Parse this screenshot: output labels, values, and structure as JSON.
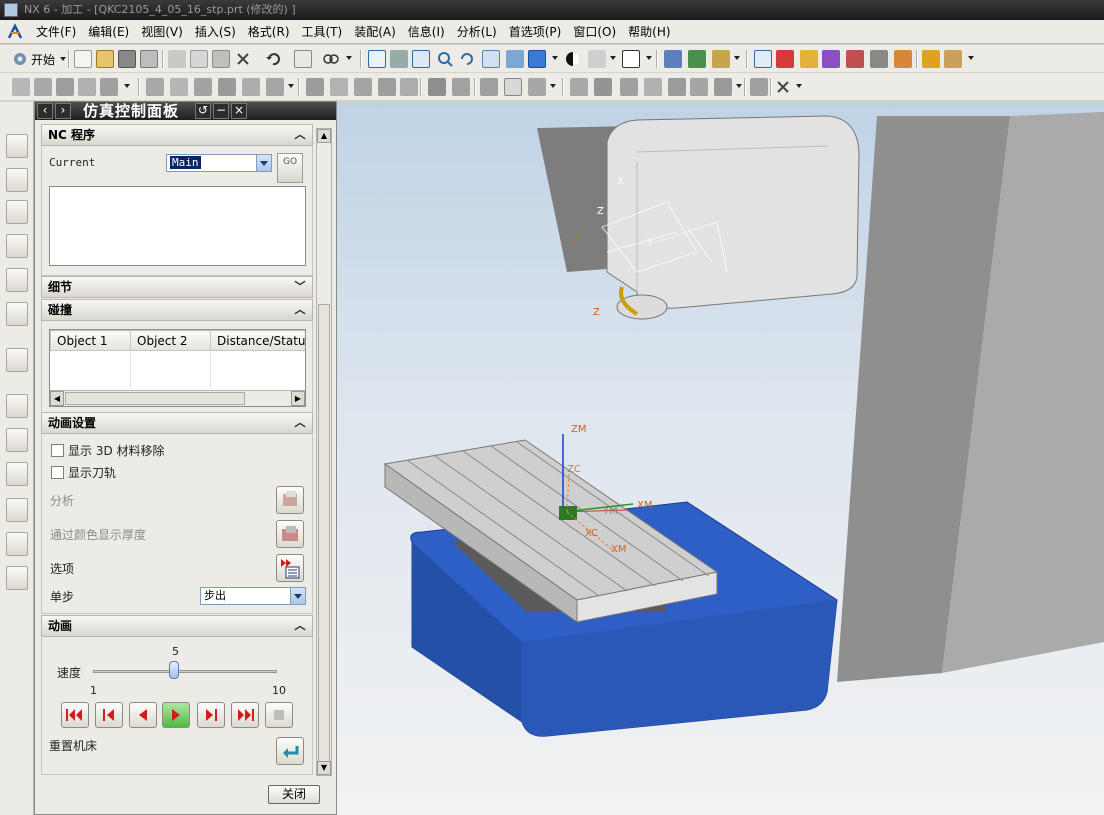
{
  "window": {
    "title": "NX 6 - 加工 - [QKC2105_4_05_16_stp.prt (修改的) ]"
  },
  "menubar": {
    "items": [
      "文件(F)",
      "编辑(E)",
      "视图(V)",
      "插入(S)",
      "格式(R)",
      "工具(T)",
      "装配(A)",
      "信息(I)",
      "分析(L)",
      "首选项(P)",
      "窗口(O)",
      "帮助(H)"
    ]
  },
  "toolbar": {
    "start_label": "开始"
  },
  "panel": {
    "title": "仿真控制面板",
    "nc": {
      "header": "NC 程序",
      "current_label": "Current",
      "current_value": "Main",
      "go_label": "GO"
    },
    "detail": {
      "header": "细节"
    },
    "collision": {
      "header": "碰撞",
      "columns": [
        "Object 1",
        "Object 2",
        "Distance/Statu"
      ]
    },
    "anim_settings": {
      "header": "动画设置",
      "show_3d_removal": "显示 3D 材料移除",
      "show_toolpath": "显示刀轨",
      "analysis": "分析",
      "color_thickness": "通过颜色显示厚度",
      "options": "选项",
      "step_label": "单步",
      "step_value": "步出"
    },
    "animation": {
      "header": "动画",
      "speed_label": "速度",
      "speed_value": "5",
      "speed_min": "1",
      "speed_max": "10",
      "speed_fraction": 0.44,
      "reset_label": "重置机床"
    },
    "close_label": "关闭"
  },
  "viewport": {
    "axis_labels": {
      "zm": "ZM",
      "zc": "ZC",
      "xm": "XM",
      "xc": "XC",
      "ym": "YM",
      "x": "X",
      "y": "Y",
      "z": "Z"
    },
    "colors": {
      "table_blue": "#2d5fc6",
      "column_gray": "#9a9a9a",
      "tool_head": "#e6e6e6"
    }
  }
}
